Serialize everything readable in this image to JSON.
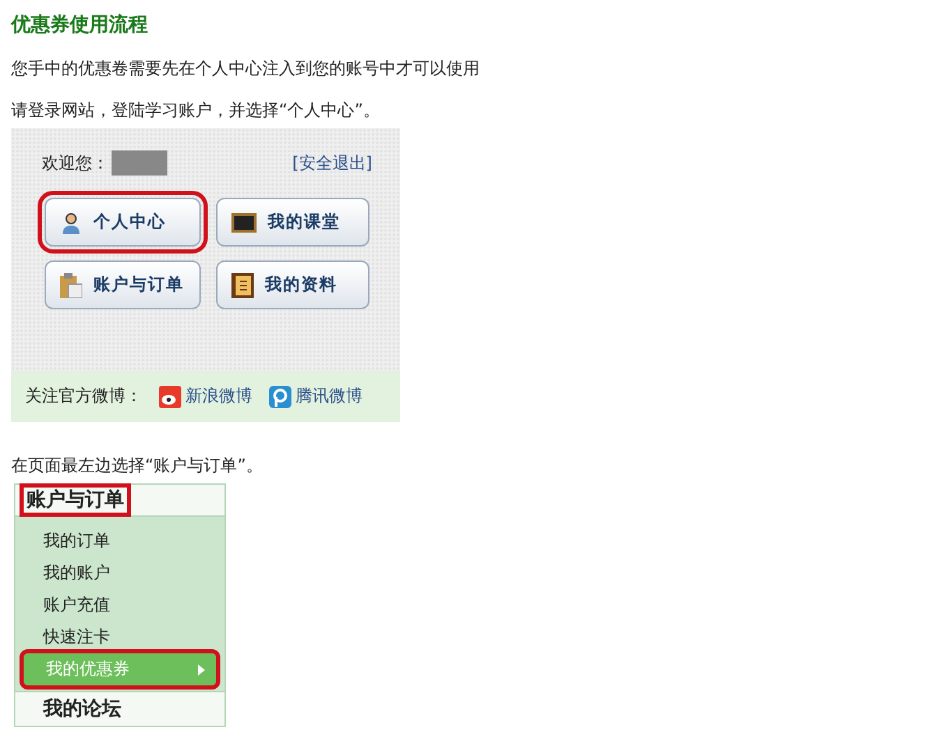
{
  "title": "优惠券使用流程",
  "intro": "您手中的优惠卷需要先在个人中心注入到您的账号中才可以使用",
  "step1": "请登录网站，登陆学习账户，并选择“个人中心”。",
  "login_panel": {
    "welcome": "欢迎您：",
    "logout": "[安全退出]",
    "buttons": [
      {
        "label": "个人中心",
        "highlighted": true
      },
      {
        "label": "我的课堂",
        "highlighted": false
      },
      {
        "label": "账户与订单",
        "highlighted": false
      },
      {
        "label": "我的资料",
        "highlighted": false
      }
    ],
    "follow_label": "关注官方微博：",
    "weibo_links": [
      {
        "label": "新浪微博"
      },
      {
        "label": "腾讯微博"
      }
    ]
  },
  "step2": "在页面最左边选择“账户与订单”。",
  "side_menu": {
    "header": "账户与订单",
    "header_highlighted": true,
    "items": [
      {
        "label": "我的订单",
        "selected": false,
        "highlighted": false
      },
      {
        "label": "我的账户",
        "selected": false,
        "highlighted": false
      },
      {
        "label": "账户充值",
        "selected": false,
        "highlighted": false
      },
      {
        "label": "快速注卡",
        "selected": false,
        "highlighted": false
      },
      {
        "label": "我的优惠券",
        "selected": true,
        "highlighted": true
      }
    ],
    "footer": "我的论坛"
  }
}
